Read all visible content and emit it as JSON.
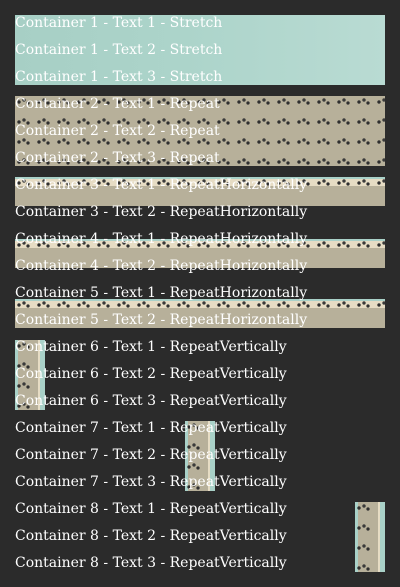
{
  "containers": [
    {
      "id": "container-1",
      "mode": "Stretch",
      "lines": [
        "Container 1 - Text 1 - Stretch",
        "Container 1 - Text 2 - Stretch",
        "Container 1 - Text 3 - Stretch"
      ]
    },
    {
      "id": "container-2",
      "mode": "Repeat",
      "lines": [
        "Container 2 - Text 1 - Repeat",
        "Container 2 - Text 2 - Repeat",
        "Container 2 - Text 3 - Repeat"
      ]
    },
    {
      "id": "container-3",
      "mode": "RepeatHorizontally",
      "lines": [
        "Container 3 - Text 1 - RepeatHorizontally",
        "Container 3 - Text 2 - RepeatHorizontally"
      ]
    },
    {
      "id": "container-4",
      "mode": "RepeatHorizontally",
      "lines": [
        "Container 4 - Text 1 - RepeatHorizontally",
        "Container 4 - Text 2 - RepeatHorizontally"
      ]
    },
    {
      "id": "container-5",
      "mode": "RepeatHorizontally",
      "lines": [
        "Container 5 - Text 1 - RepeatHorizontally",
        "Container 5 - Text 2 - RepeatHorizontally"
      ]
    },
    {
      "id": "container-6",
      "mode": "RepeatVertically",
      "lines": [
        "Container 6 - Text 1 - RepeatVertically",
        "Container 6 - Text 2 - RepeatVertically",
        "Container 6 - Text 3 - RepeatVertically"
      ]
    },
    {
      "id": "container-7",
      "mode": "RepeatVertically",
      "lines": [
        "Container 7 - Text 1 - RepeatVertically",
        "Container 7 - Text 2 - RepeatVertically",
        "Container 7 - Text 3 - RepeatVertically"
      ]
    },
    {
      "id": "container-8",
      "mode": "RepeatVertically",
      "lines": [
        "Container 8 - Text 1 - RepeatVertically",
        "Container 8 - Text 2 - RepeatVertically",
        "Container 8 - Text 3 - RepeatVertically"
      ]
    }
  ],
  "colors": {
    "page_background": "#2b2b2b",
    "text": "#ffffff",
    "image_sky": "#a9d1c8"
  }
}
